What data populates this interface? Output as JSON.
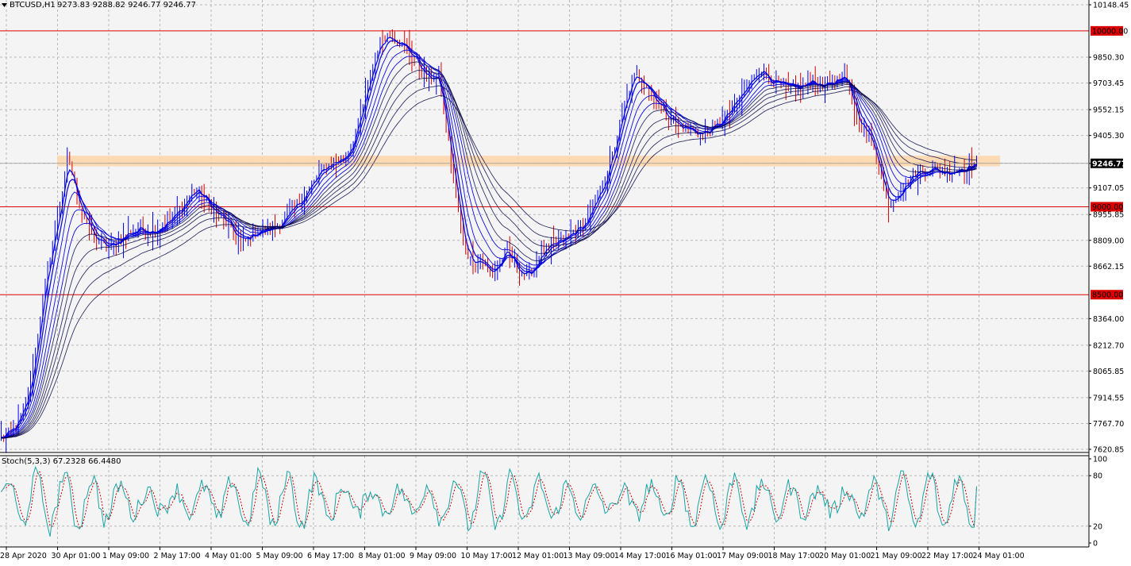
{
  "header": {
    "symbol_label": "BTCUSD,H1",
    "ohlc_label": "9273.83 9288.82 9246.77 9246.77"
  },
  "stoch_header": {
    "label": "Stoch(5,3,3) 67.2328 66.4480"
  },
  "colors": {
    "bg": "#f4f4f4",
    "grid": "#b8b8b8",
    "candle_up": "#0000ee",
    "candle_down": "#d00000",
    "ma_fast": "#0000dd",
    "ma_slow": "#000044",
    "level_line": "#dd0000",
    "zone": "#fcd5a8",
    "stoch_main": "#1aa5a5",
    "stoch_signal": "#cc0000"
  },
  "chart_data": [
    {
      "type": "candlestick",
      "series": [
        {
          "name": "BTCUSD,H1",
          "close": [
            7690,
            7705,
            7725,
            7760,
            7820,
            7900,
            8050,
            8250,
            8450,
            8650,
            8800,
            8950,
            9100,
            9280,
            9150,
            9020,
            8950,
            8880,
            8820,
            8800,
            8780,
            8760,
            8790,
            8810,
            8840,
            8860,
            8860,
            8880,
            8870,
            8860,
            8870,
            8890,
            8910,
            8930,
            8960,
            9000,
            9040,
            9080,
            9100,
            9060,
            9020,
            8980,
            8950,
            8930,
            8900,
            8850,
            8820,
            8800,
            8820,
            8850,
            8860,
            8870,
            8880,
            8890,
            8900,
            8930,
            8960,
            9000,
            9040,
            9080,
            9120,
            9160,
            9200,
            9230,
            9250,
            9260,
            9270,
            9300,
            9360,
            9450,
            9560,
            9680,
            9800,
            9900,
            9960,
            9980,
            9970,
            9940,
            9910,
            9880,
            9850,
            9800,
            9750,
            9720,
            9740,
            9700,
            9500,
            9300,
            9100,
            8900,
            8750,
            8700,
            8680,
            8700,
            8650,
            8620,
            8650,
            8700,
            8750,
            8700,
            8650,
            8620,
            8600,
            8640,
            8700,
            8740,
            8760,
            8780,
            8800,
            8810,
            8830,
            8860,
            8880,
            8900,
            8950,
            9010,
            9080,
            9160,
            9250,
            9360,
            9480,
            9600,
            9700,
            9750,
            9740,
            9700,
            9650,
            9600,
            9560,
            9520,
            9500,
            9460,
            9450,
            9440,
            9430,
            9420,
            9410,
            9430,
            9450,
            9470,
            9500,
            9540,
            9580,
            9620,
            9660,
            9700,
            9750,
            9790,
            9760,
            9720,
            9700,
            9690,
            9680,
            9670,
            9660,
            9680,
            9700,
            9710,
            9700,
            9690,
            9700,
            9710,
            9720,
            9730,
            9700,
            9600,
            9500,
            9450,
            9400,
            9350,
            9250,
            9100,
            9020,
            9050,
            9080,
            9120,
            9160,
            9190,
            9200,
            9210,
            9220,
            9210,
            9200,
            9190,
            9200,
            9210,
            9220,
            9230,
            9240,
            9246.77
          ]
        }
      ],
      "ylim": [
        7620.85,
        10148.45
      ],
      "y_ticks": [
        "10148.45",
        "9850.30",
        "9703.45",
        "9552.15",
        "9405.30",
        "9246.77",
        "9107.05",
        "8955.85",
        "8809.00",
        "8662.15",
        "8364.00",
        "8212.70",
        "8065.85",
        "7914.55",
        "7767.70",
        "7620.85"
      ],
      "x_ticks": [
        "28 Apr 2020",
        "30 Apr 01:00",
        "1 May 09:00",
        "2 May 17:00",
        "4 May 01:00",
        "5 May 09:00",
        "6 May 17:00",
        "8 May 01:00",
        "9 May 09:00",
        "10 May 17:00",
        "12 May 01:00",
        "13 May 09:00",
        "14 May 17:00",
        "16 May 01:00",
        "17 May 09:00",
        "18 May 17:00",
        "20 May 01:00",
        "21 May 09:00",
        "22 May 17:00",
        "24 May 01:00"
      ],
      "horizontal_levels": [
        {
          "label": "10000.00",
          "value": 10000
        },
        {
          "label": "9000.00",
          "value": 9000
        },
        {
          "label": "8500.00",
          "value": 8500
        }
      ],
      "zone": {
        "from": 9230,
        "to": 9290
      },
      "current_price": {
        "label": "9246.77",
        "value": 9246.77
      },
      "moving_averages": [
        "ma-3",
        "ma-5",
        "ma-8",
        "ma-12",
        "ma-16",
        "ma-20",
        "ma-26",
        "ma-32",
        "ma-40",
        "ma-50"
      ],
      "grid": true
    },
    {
      "type": "line",
      "ylim": [
        0,
        100
      ],
      "y_ticks": [
        "100",
        "80",
        "20",
        "0"
      ],
      "levels": [
        20,
        80
      ],
      "series": [
        {
          "name": "%K",
          "values": [
            67.2328
          ]
        },
        {
          "name": "%D",
          "values": [
            66.448
          ]
        }
      ],
      "grid": true
    }
  ]
}
